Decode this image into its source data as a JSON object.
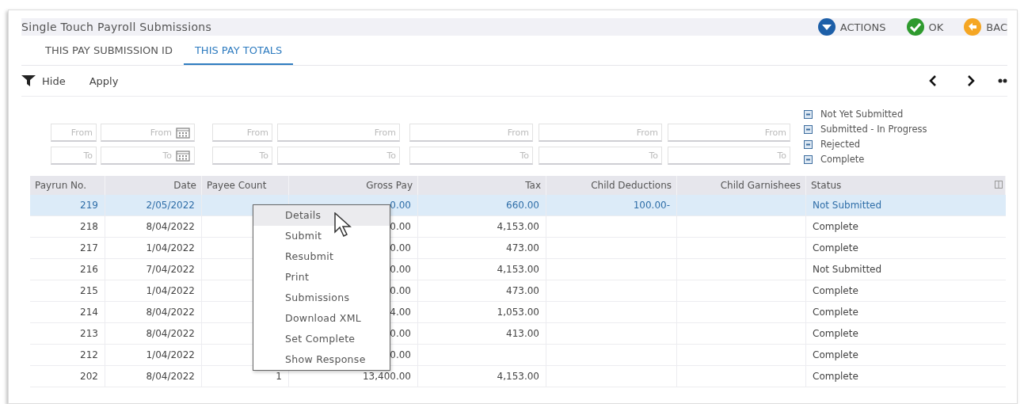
{
  "window": {
    "title": "Single Touch Payroll Submissions"
  },
  "header_buttons": [
    {
      "label": "ACTIONS",
      "kind": "actions"
    },
    {
      "label": "OK",
      "kind": "ok"
    },
    {
      "label": "BAC",
      "kind": "back"
    }
  ],
  "tabs": [
    {
      "label": "THIS PAY SUBMISSION ID",
      "selected": false
    },
    {
      "label": "THIS PAY TOTALS",
      "selected": true
    }
  ],
  "toolbar": {
    "hide": "Hide",
    "apply": "Apply"
  },
  "filters": [
    {
      "kind": "text",
      "from": {
        "placeholder": "From"
      },
      "to": {
        "placeholder": "To"
      }
    },
    {
      "kind": "date",
      "from": {
        "placeholder": "From"
      },
      "to": {
        "placeholder": "To"
      }
    },
    {
      "kind": "text",
      "from": {
        "placeholder": "From"
      },
      "to": {
        "placeholder": "To"
      }
    },
    {
      "kind": "text",
      "from": {
        "placeholder": "From"
      },
      "to": {
        "placeholder": "To"
      }
    },
    {
      "kind": "text",
      "from": {
        "placeholder": "From"
      },
      "to": {
        "placeholder": "To"
      }
    },
    {
      "kind": "text",
      "from": {
        "placeholder": "From"
      },
      "to": {
        "placeholder": "To"
      }
    },
    {
      "kind": "text",
      "from": {
        "placeholder": "From"
      },
      "to": {
        "placeholder": "To"
      }
    }
  ],
  "legend": [
    "Not Yet Submitted",
    "Submitted - In Progress",
    "Rejected",
    "Complete"
  ],
  "table": {
    "columns": [
      "Payrun No.",
      "Date",
      "Payee Count",
      "Gross Pay",
      "Tax",
      "Child Deductions",
      "Child Garnishees",
      "Status"
    ],
    "rows": [
      {
        "selected": true,
        "cells": [
          "219",
          "2/05/2022",
          null,
          "0.00",
          "660.00",
          "100.00-",
          null,
          "Not Submitted"
        ]
      },
      {
        "selected": false,
        "cells": [
          "218",
          "8/04/2022",
          null,
          "0.00",
          "4,153.00",
          null,
          null,
          "Complete"
        ]
      },
      {
        "selected": false,
        "cells": [
          "217",
          "1/04/2022",
          null,
          "0.00",
          "473.00",
          null,
          null,
          "Complete"
        ]
      },
      {
        "selected": false,
        "cells": [
          "216",
          "7/04/2022",
          null,
          "0.00",
          "4,153.00",
          null,
          null,
          "Not Submitted"
        ]
      },
      {
        "selected": false,
        "cells": [
          "215",
          "1/04/2022",
          null,
          "0.00",
          "473.00",
          null,
          null,
          "Complete"
        ]
      },
      {
        "selected": false,
        "cells": [
          "214",
          "8/04/2022",
          null,
          "4.00",
          "1,053.00",
          null,
          null,
          "Complete"
        ]
      },
      {
        "selected": false,
        "cells": [
          "213",
          "8/04/2022",
          null,
          "0.00",
          "413.00",
          null,
          null,
          "Complete"
        ]
      },
      {
        "selected": false,
        "cells": [
          "212",
          "1/04/2022",
          null,
          "0.00",
          null,
          null,
          null,
          "Complete"
        ]
      },
      {
        "selected": false,
        "cells": [
          "202",
          "8/04/2022",
          "1",
          "13,400.00",
          "4,153.00",
          null,
          null,
          "Complete"
        ]
      }
    ]
  },
  "context_menu": {
    "items": [
      {
        "label": "Details",
        "selected": true
      },
      {
        "label": "Submit",
        "selected": false
      },
      {
        "label": "Resubmit",
        "selected": false
      },
      {
        "label": "Print",
        "selected": false
      },
      {
        "label": "Submissions",
        "selected": false
      },
      {
        "label": "Download XML",
        "selected": false
      },
      {
        "label": "Set Complete",
        "selected": false
      },
      {
        "label": "Show Response",
        "selected": false
      }
    ]
  }
}
